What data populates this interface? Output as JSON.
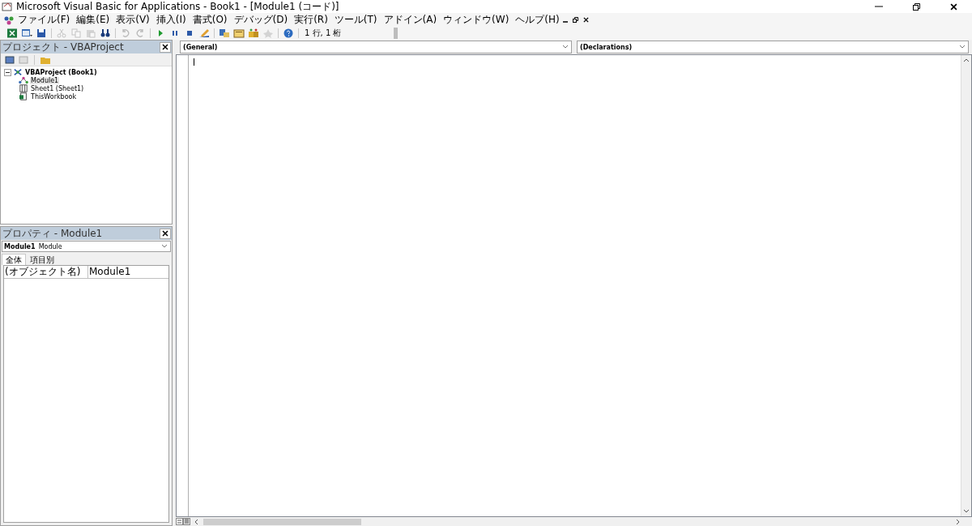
{
  "window": {
    "title": "Microsoft Visual Basic for Applications - Book1 - [Module1 (コード)]"
  },
  "menu": [
    "ファイル(F)",
    "編集(E)",
    "表示(V)",
    "挿入(I)",
    "書式(O)",
    "デバッグ(D)",
    "実行(R)",
    "ツール(T)",
    "アドイン(A)",
    "ウィンドウ(W)",
    "ヘルプ(H)"
  ],
  "toolbar": {
    "buttons": [
      {
        "kind": "excel",
        "disabled": false
      },
      {
        "kind": "insert",
        "disabled": false
      },
      {
        "kind": "save",
        "disabled": false
      },
      {
        "kind": "separator"
      },
      {
        "kind": "cut",
        "disabled": true
      },
      {
        "kind": "copy",
        "disabled": true
      },
      {
        "kind": "paste",
        "disabled": true
      },
      {
        "kind": "find",
        "disabled": false
      },
      {
        "kind": "separator"
      },
      {
        "kind": "undo",
        "disabled": true
      },
      {
        "kind": "redo",
        "disabled": true
      },
      {
        "kind": "separator"
      },
      {
        "kind": "run",
        "disabled": false
      },
      {
        "kind": "pause",
        "disabled": false
      },
      {
        "kind": "stop",
        "disabled": false
      },
      {
        "kind": "design",
        "disabled": false
      },
      {
        "kind": "separator"
      },
      {
        "kind": "project",
        "disabled": false
      },
      {
        "kind": "properties",
        "disabled": false
      },
      {
        "kind": "browser",
        "disabled": false
      },
      {
        "kind": "toolbox",
        "disabled": true
      },
      {
        "kind": "separator"
      },
      {
        "kind": "help",
        "disabled": false
      }
    ],
    "position": "1 行, 1 桁"
  },
  "project_panel": {
    "title": "プロジェクト - VBAProject",
    "tree": [
      {
        "label": "VBAProject (Book1)",
        "kind": "project",
        "expanded": true,
        "selected": false,
        "children": [
          {
            "label": "Module1",
            "kind": "module",
            "selected": true
          },
          {
            "label": "Sheet1 (Sheet1)",
            "kind": "sheet",
            "selected": false
          },
          {
            "label": "ThisWorkbook",
            "kind": "workbook",
            "selected": false
          }
        ]
      }
    ]
  },
  "properties_panel": {
    "title": "プロパティ - Module1",
    "object_name": "Module1",
    "object_type": "Module",
    "tabs": [
      {
        "label": "全体",
        "selected": true
      },
      {
        "label": "項目別",
        "selected": false
      }
    ],
    "rows": [
      {
        "name": "(オブジェクト名)",
        "value": "Module1"
      }
    ]
  },
  "code_window": {
    "object": "(General)",
    "procedure": "(Declarations)"
  }
}
